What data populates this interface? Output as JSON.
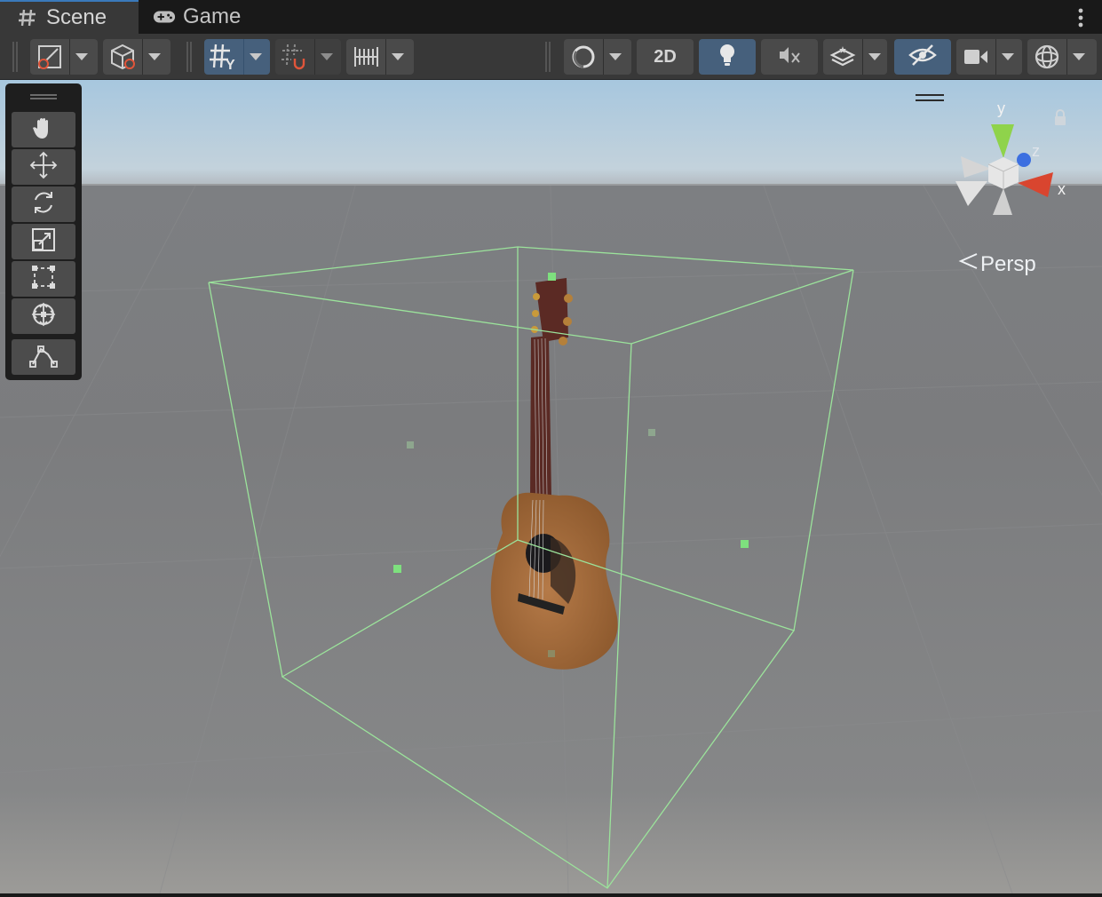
{
  "tabs": [
    {
      "label": "Scene",
      "active": true,
      "icon": "grid-hash-icon"
    },
    {
      "label": "Game",
      "active": false,
      "icon": "gamepad-icon"
    }
  ],
  "toolbar": {
    "draw_mode": "shaded-draw-mode-icon",
    "orientation_2d": "2D",
    "grid_axis": "Y",
    "lighting_on": true,
    "grid_on": true,
    "hidden_objects_toggle_on": true
  },
  "tools": [
    "hand-tool",
    "move-tool",
    "rotate-tool",
    "scale-tool",
    "rect-tool",
    "transform-tool",
    "custom-editor-tool"
  ],
  "gizmo": {
    "axis_y": "y",
    "axis_z": "z",
    "axis_x": "x",
    "projection": "Persp"
  },
  "colors": {
    "accent": "#3a79bb",
    "selection_outline": "#9be39b",
    "axis_x": "#d9452f",
    "axis_y": "#8fd34b",
    "axis_z": "#3c6fe0"
  }
}
